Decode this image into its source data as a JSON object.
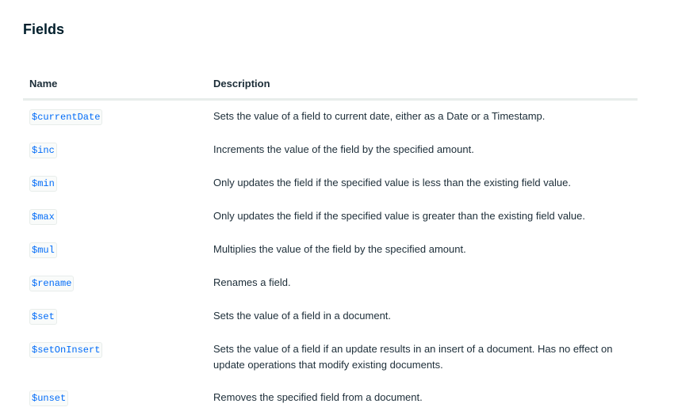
{
  "title": "Fields",
  "columns": {
    "name": "Name",
    "description": "Description"
  },
  "rows": [
    {
      "name": "$currentDate",
      "description": "Sets the value of a field to current date, either as a Date or a Timestamp."
    },
    {
      "name": "$inc",
      "description": "Increments the value of the field by the specified amount."
    },
    {
      "name": "$min",
      "description": "Only updates the field if the specified value is less than the existing field value."
    },
    {
      "name": "$max",
      "description": "Only updates the field if the specified value is greater than the existing field value."
    },
    {
      "name": "$mul",
      "description": "Multiplies the value of the field by the specified amount."
    },
    {
      "name": "$rename",
      "description": "Renames a field."
    },
    {
      "name": "$set",
      "description": "Sets the value of a field in a document."
    },
    {
      "name": "$setOnInsert",
      "description": "Sets the value of a field if an update results in an insert of a document. Has no effect on update operations that modify existing documents."
    },
    {
      "name": "$unset",
      "description": "Removes the specified field from a document."
    }
  ],
  "colors": {
    "link": "#016bf8",
    "heading": "#001e2b",
    "divider": "#e8edeb"
  }
}
